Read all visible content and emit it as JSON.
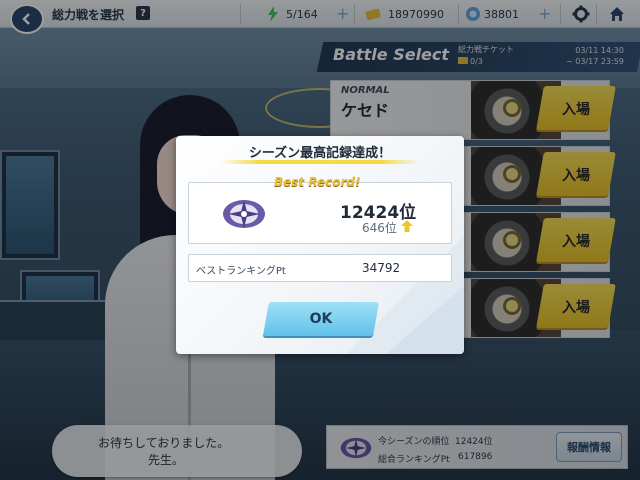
{
  "header": {
    "title": "総力戦を選択",
    "help_icon": "?",
    "ap": "5/164",
    "credits": "18970990",
    "gems": "38801",
    "plus": "+"
  },
  "battle_select": {
    "title": "Battle Select",
    "ticket_label": "総力戦チケット",
    "ticket_count": "0/3",
    "date_start": "03/11 14:30",
    "date_end": "~ 03/17 23:59",
    "rows": [
      {
        "difficulty": "NORMAL",
        "boss": "ケセド",
        "enter": "入場"
      },
      {
        "difficulty": "",
        "boss": "",
        "enter": "入場"
      },
      {
        "difficulty": "",
        "boss": "",
        "enter": "入場"
      },
      {
        "difficulty": "",
        "boss": "",
        "enter": "入場"
      }
    ]
  },
  "dialog": {
    "line1": "お待ちしておりました。",
    "line2": "先生。"
  },
  "ranking": {
    "season_rank_label": "今シーズンの順位",
    "season_rank_value": "12424位",
    "total_pt_label": "総合ランキングPt",
    "total_pt_value": "617896",
    "reward_button": "報酬情報"
  },
  "modal": {
    "title": "シーズン最高記録達成！",
    "best_record_label": "Best Record!",
    "best_rank": "12424位",
    "previous_rank": "646位",
    "best_pt_label": "ベストランキングPt",
    "best_pt_value": "34792",
    "ok_button": "OK"
  },
  "colors": {
    "accent_yellow": "#f6d840",
    "ok_blue": "#61c2ea",
    "navy": "#2a4a6e"
  }
}
